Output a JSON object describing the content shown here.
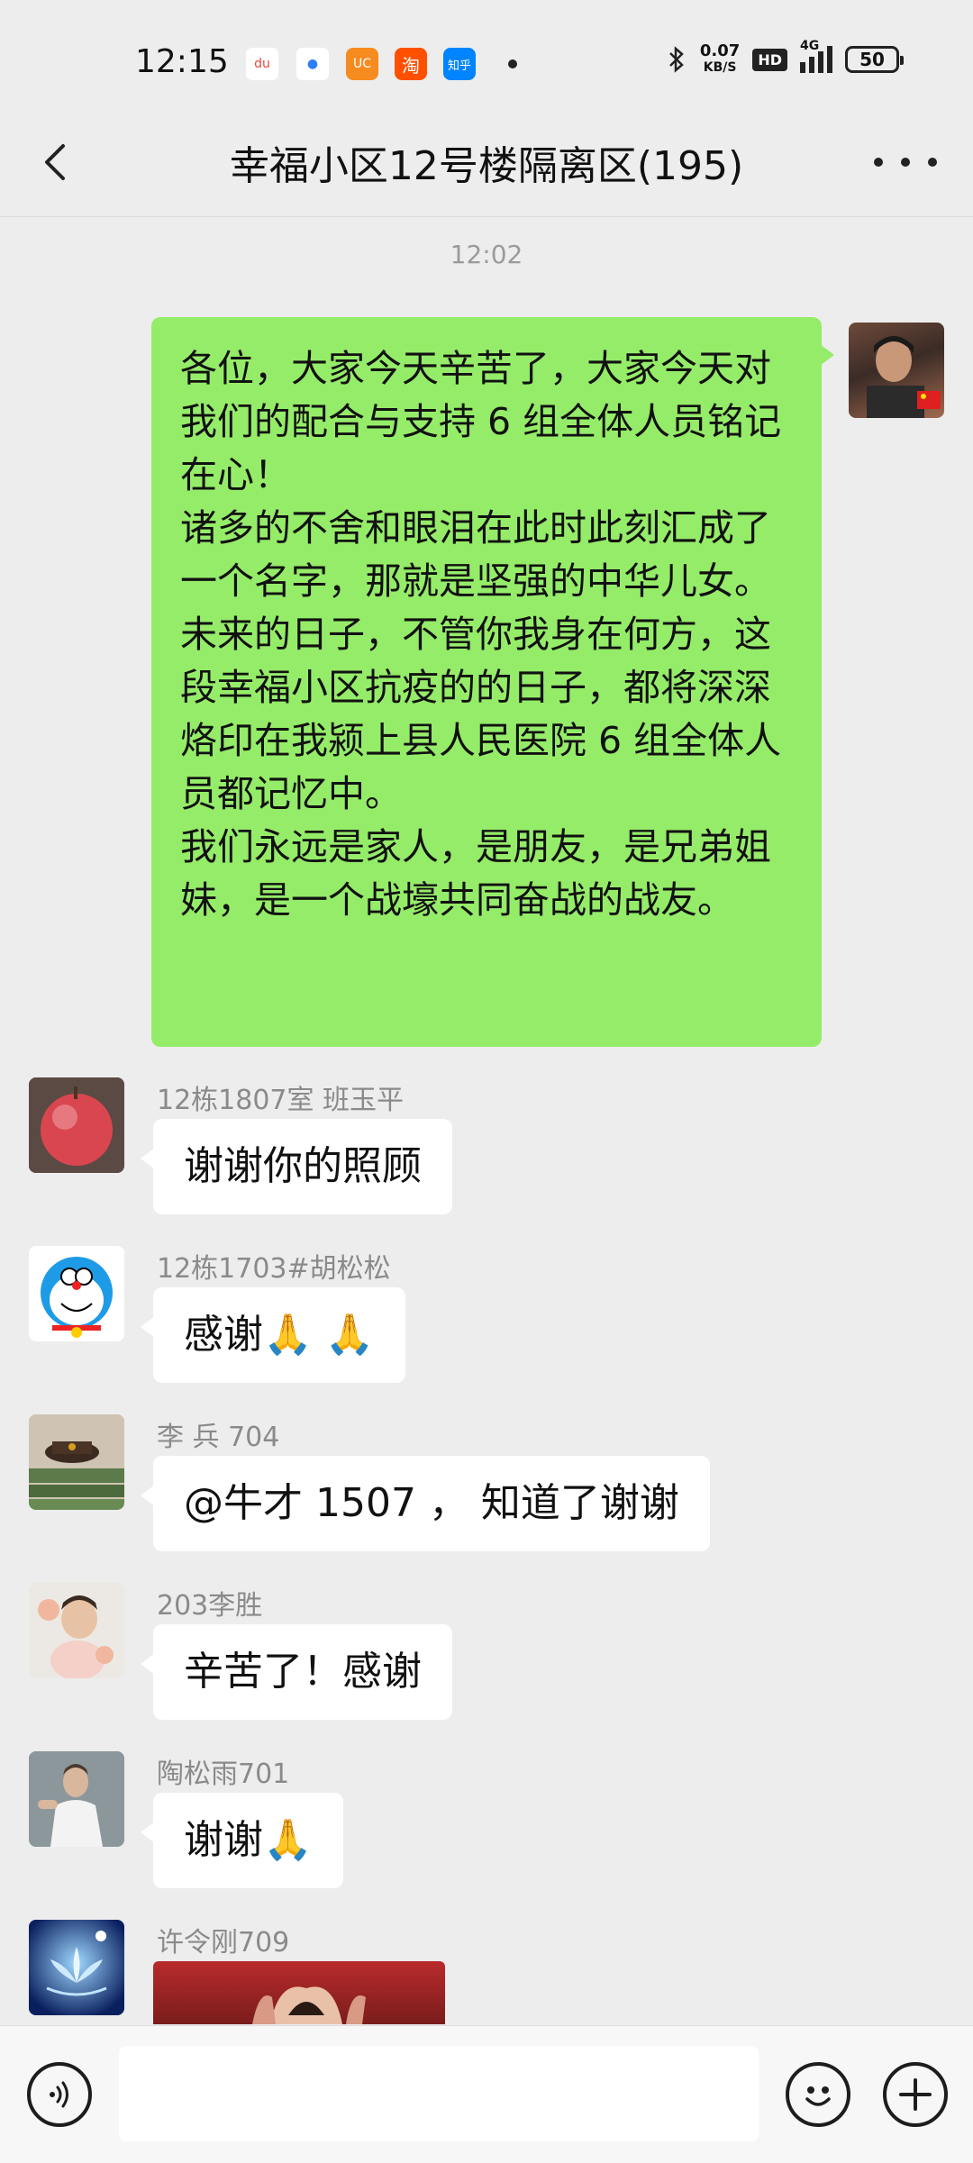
{
  "status_bar": {
    "time": "12:15",
    "apps": [
      {
        "name": "baidu-maps",
        "label": "du",
        "color": "#e8463a",
        "bg": "#ffffff"
      },
      {
        "name": "browser",
        "label": "●",
        "color": "#2e7df6",
        "bg": "#ffffff"
      },
      {
        "name": "uc-browser",
        "label": "UC",
        "color": "#ffffff",
        "bg": "#f68b1f"
      },
      {
        "name": "taobao",
        "label": "淘",
        "color": "#ffffff",
        "bg": "#ff5000"
      },
      {
        "name": "zhihu",
        "label": "知乎",
        "color": "#ffffff",
        "bg": "#0084ff"
      }
    ],
    "net_speed": "0.07",
    "net_unit": "KB/S",
    "hd": "HD",
    "network": "4G",
    "battery": "50"
  },
  "nav": {
    "title": "幸福小区12号楼隔离区(195)"
  },
  "chat": {
    "timestamp": "12:02",
    "outgoing": {
      "paragraphs": [
        "各位，大家今天辛苦了，大家今天对我们的配合与支持 6 组全体人员铭记在心！",
        "诸多的不舍和眼泪在此时此刻汇成了一个名字，那就是坚强的中华儿女。",
        "未来的日子，不管你我身在何方，这段幸福小区抗疫的的日子，都将深深烙印在我颍上县人民医院 6 组全体人员都记忆中。",
        "我们永远是家人，是朋友，是兄弟姐妹，是一个战壕共同奋战的战友。"
      ]
    },
    "messages": [
      {
        "sender": "12栋1807室  班玉平",
        "text": "谢谢你的照顾",
        "avatar": "apple-avatar"
      },
      {
        "sender": "12栋1703#胡松松",
        "text": "感谢🙏 🙏",
        "avatar": "doraemon-avatar"
      },
      {
        "sender": "李  兵  704",
        "text": "@牛才 1507 ，  知道了谢谢",
        "avatar": "books-avatar"
      },
      {
        "sender": "203李胜",
        "text": "辛苦了！感谢",
        "avatar": "child-avatar"
      },
      {
        "sender": "陶松雨701",
        "text": "谢谢🙏",
        "avatar": "man-avatar"
      },
      {
        "sender": "许令刚709",
        "text": "",
        "avatar": "lotus-avatar"
      }
    ]
  },
  "input": {
    "placeholder": ""
  }
}
